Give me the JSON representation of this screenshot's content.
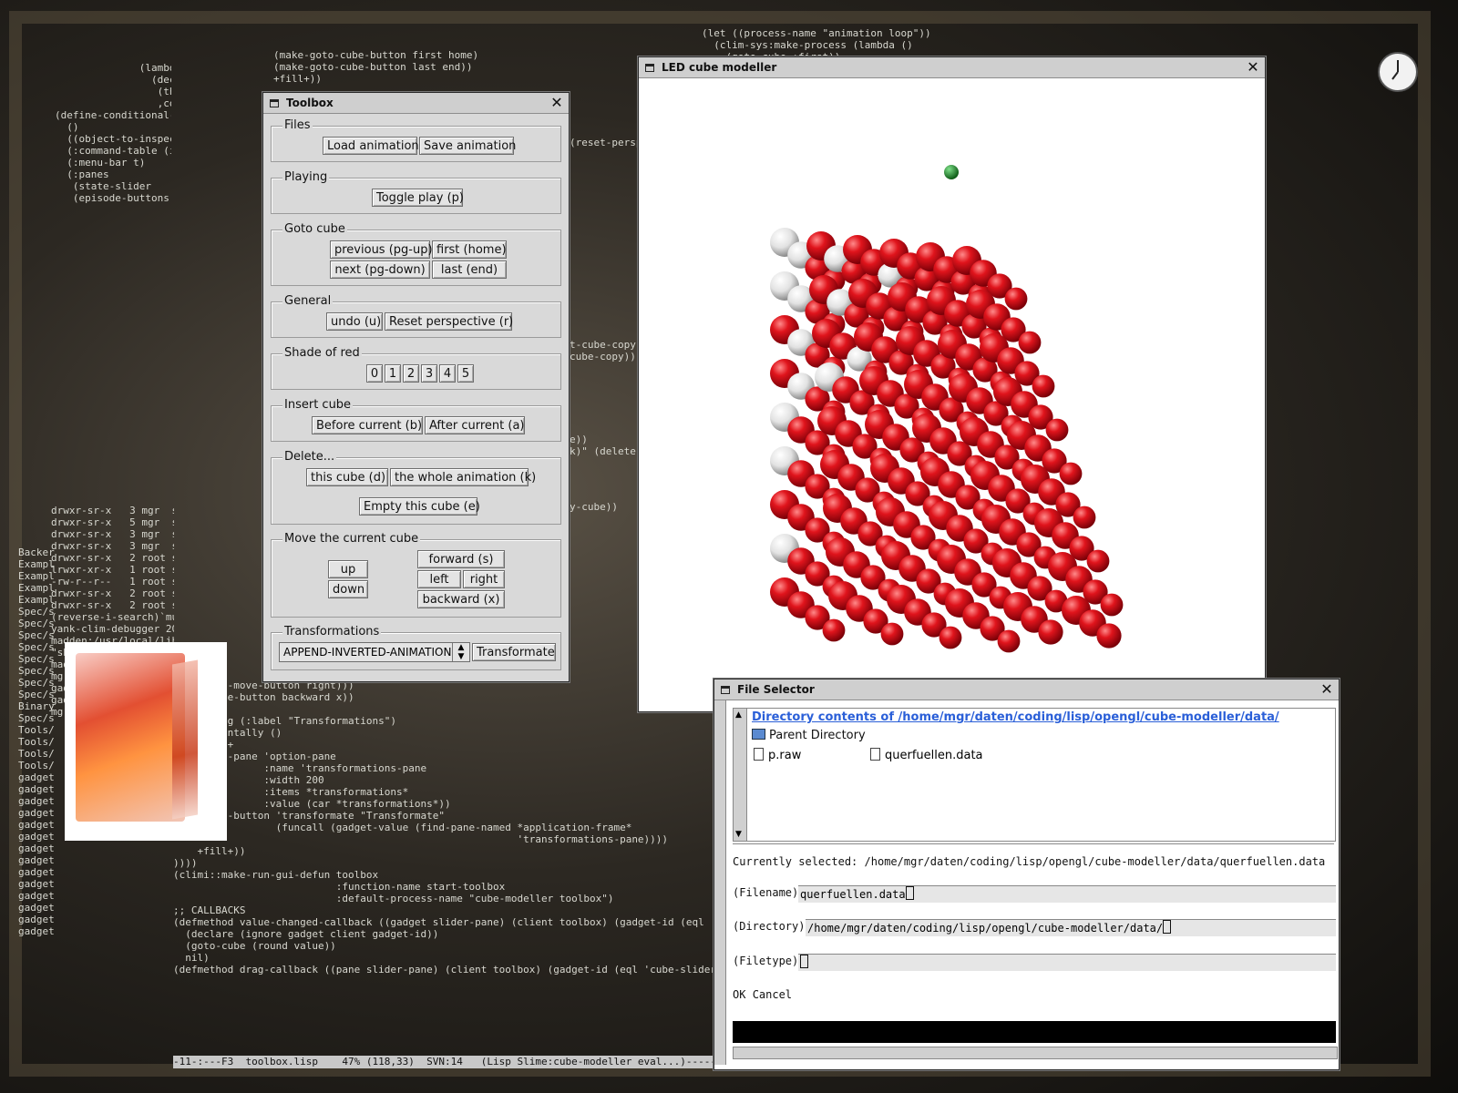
{
  "terminal_left": {
    "lines": [
      "drwxr-sr-x   3 mgr  sr",
      "drwxr-sr-x   5 mgr  sr",
      "drwxr-sr-x   3 mgr  sr",
      "drwxr-sr-x   3 mgr  sr",
      "drwxr-sr-x   2 root st",
      "lrwxr-xr-x   1 root st",
      "-rw-r--r--   1 root st",
      "drwxr-sr-x   2 root st",
      "drwxr-sr-x   2 root st",
      "(reverse-i-search)`mu'",
      "yank-clim-debugger 20",
      "madden:/usr/local/lib/",
      "\"sbcl.core\" may be a b",
      "madden:/usr/local/lib/",
      "mgr@madden:/usr/src/li",
      "gadgets.lisp:(defun generic-c",
      "gadgets.lisp:",
      "mgr@madden:/usr/src/lisp/site/mcclim$"
    ]
  },
  "editor": {
    "top_lines": [
      "(make-goto-cube-button first home)",
      "(make-goto-cube-button last end))",
      "+fill+))"
    ],
    "bottom_lines": [
      "(50 (make-move-button right)))",
      "(make-move-button backward x))",
      "+fill+))",
      "(labelling (:label \"Transformations\")",
      "  (horizontally ()",
      "    +fill+",
      "    (make-pane 'option-pane",
      "               :name 'transformations-pane",
      "               :width 200",
      "               :items *transformations*",
      "               :value (car *transformations*))",
      "    (make-button 'transformate \"Transformate\"",
      "                 (funcall (gadget-value (find-pane-named *application-frame*",
      "                                                         'transformations-pane))))",
      "    +fill+))",
      "",
      "))))",
      "",
      "(climi::make-run-gui-defun toolbox",
      "                           :function-name start-toolbox",
      "                           :default-process-name \"cube-modeller toolbox\")",
      "",
      ";; CALLBACKS",
      "",
      "(defmethod value-changed-callback ((gadget slider-pane) (client toolbox) (gadget-id (eql 'cube-slider",
      "  (declare (ignore gadget client gadget-id))",
      "  (goto-cube (round value))",
      "  nil)",
      "",
      "(defmethod drag-callback ((pane slider-pane) (client toolbox) (gadget-id (eql 'cube-slider-gadget)) v"
    ],
    "modeline": "-11-:---F3  toolbox.lisp    47% (118,33)  SVN:14   (Lisp Slime:cube-modeller eval...)---------------------",
    "top_right_lines": [
      "(let ((process-name \"animation loop\"))",
      "  (clim-sys:make-process (lambda ()",
      "    (goto-cube :first))"
    ],
    "side_snippets": [
      "(reset-persp",
      "t-cube-copy :",
      "cube-copy))",
      "e))",
      "k)\" (delete-c",
      "y-cube))"
    ]
  },
  "left_code": {
    "lines": [
      "              (lambda",
      "                (decla",
      "                 (thro",
      "                 ,comm",
      "",
      "(define-conditional-ap",
      "  ()",
      "  ((object-to-inspect",
      "  (:command-table (ip",
      "",
      "",
      "",
      "",
      "  (:menu-bar t)",
      "  (:panes",
      "   (state-slider",
      "",
      "",
      "",
      "",
      "",
      "",
      "",
      "",
      "   (episode-buttons (h"
    ]
  },
  "small_list": [
    "Backer",
    "Exampl",
    "Exampl",
    "Exampl",
    "Exampl",
    "Spec/s",
    "Spec/s",
    "Spec/s",
    "Spec/s",
    "Spec/s",
    "Spec/s",
    "Spec/s",
    "Spec/s",
    "Binary",
    "Spec/s",
    "Tools/",
    "Tools/",
    "Tools/",
    "Tools/",
    "gadget",
    "gadget",
    "gadget",
    "gadget",
    "gadget",
    "gadget",
    "gadget",
    "gadget",
    "gadget",
    "gadget",
    "gadget",
    "gadget",
    "gadget",
    "gadget"
  ],
  "toolbox": {
    "title": "Toolbox",
    "files": {
      "label": "Files",
      "load": "Load animation",
      "save": "Save animation"
    },
    "playing": {
      "label": "Playing",
      "toggle": "Toggle play (p)"
    },
    "goto": {
      "label": "Goto cube",
      "previous": "previous (pg-up)",
      "first": "first (home)",
      "next": "next (pg-down)",
      "last": "last (end)"
    },
    "general": {
      "label": "General",
      "undo": "undo (u)",
      "reset": "Reset perspective (r)"
    },
    "shade": {
      "label": "Shade of red",
      "values": [
        "0",
        "1",
        "2",
        "3",
        "4",
        "5"
      ]
    },
    "insert": {
      "label": "Insert cube",
      "before": "Before current (b)",
      "after": "After current (a)"
    },
    "delete": {
      "label": "Delete...",
      "this_cube": "this cube (d)",
      "whole": "the whole animation (k)",
      "empty": "Empty this cube (e)"
    },
    "move": {
      "label": "Move the current cube",
      "up": "up",
      "down": "down",
      "forward": "forward (s)",
      "left": "left",
      "right": "right",
      "backward": "backward (x)"
    },
    "transform": {
      "label": "Transformations",
      "selected": "APPEND-INVERTED-ANIMATION",
      "button": "Transformate"
    }
  },
  "led_modeller": {
    "title": "LED cube modeller",
    "colors": {
      "on": "#d8101a",
      "off": "#e8e8e8",
      "marker": "#1e8a2a"
    }
  },
  "file_selector": {
    "title": "File Selector",
    "heading": "Directory contents of /home/mgr/daten/coding/lisp/opengl/cube-modeller/data/",
    "parent": "Parent Directory",
    "files": [
      "p.raw",
      "querfuellen.data"
    ],
    "currently_selected_label": "Currently selected:",
    "currently_selected_value": "/home/mgr/daten/coding/lisp/opengl/cube-modeller/data/querfuellen.data",
    "filename_label": "(Filename)",
    "filename_value": "querfuellen.data",
    "directory_label": "(Directory)",
    "directory_value": "/home/mgr/daten/coding/lisp/opengl/cube-modeller/data/",
    "filetype_label": "(Filetype)",
    "filetype_value": "",
    "ok": "OK",
    "cancel": "Cancel"
  }
}
